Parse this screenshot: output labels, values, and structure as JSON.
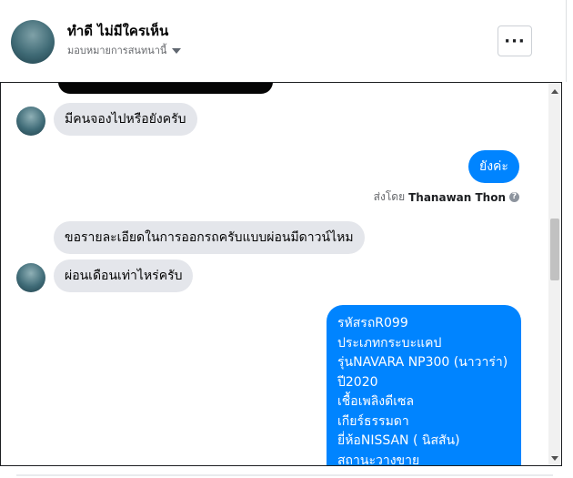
{
  "header": {
    "contact_name": "ทำดี ไม่มีใครเห็น",
    "subtitle": "มอบหมายการสนทนานี้",
    "more_label": "···"
  },
  "messages": {
    "m1": "มีคนจองไปหรือยังครับ",
    "m2": "ยังค่ะ",
    "sent_by_prefix": "ส่งโดย",
    "sent_by_name": "Thanawan Thon",
    "m3": "ขอรายละเอียดในการออกรถครับแบบผ่อนมีดาวน์ไหม",
    "m4": "ผ่อนเดือนเท่าไหร่ครับ",
    "details": [
      "รหัสรถR099",
      "ประเภทกระบะแคป",
      "รุ่นNAVARA NP300 (นาวาร่า)",
      "ปี2020",
      "เชื้อเพลิงดีเซล",
      "เกียร์ธรรมดา",
      "ยี่ห้อNISSAN ( นิสสัน)",
      "สถานะวางขาย"
    ]
  },
  "colors": {
    "outgoing_bubble": "#0084ff",
    "incoming_bubble": "#e4e6eb"
  }
}
